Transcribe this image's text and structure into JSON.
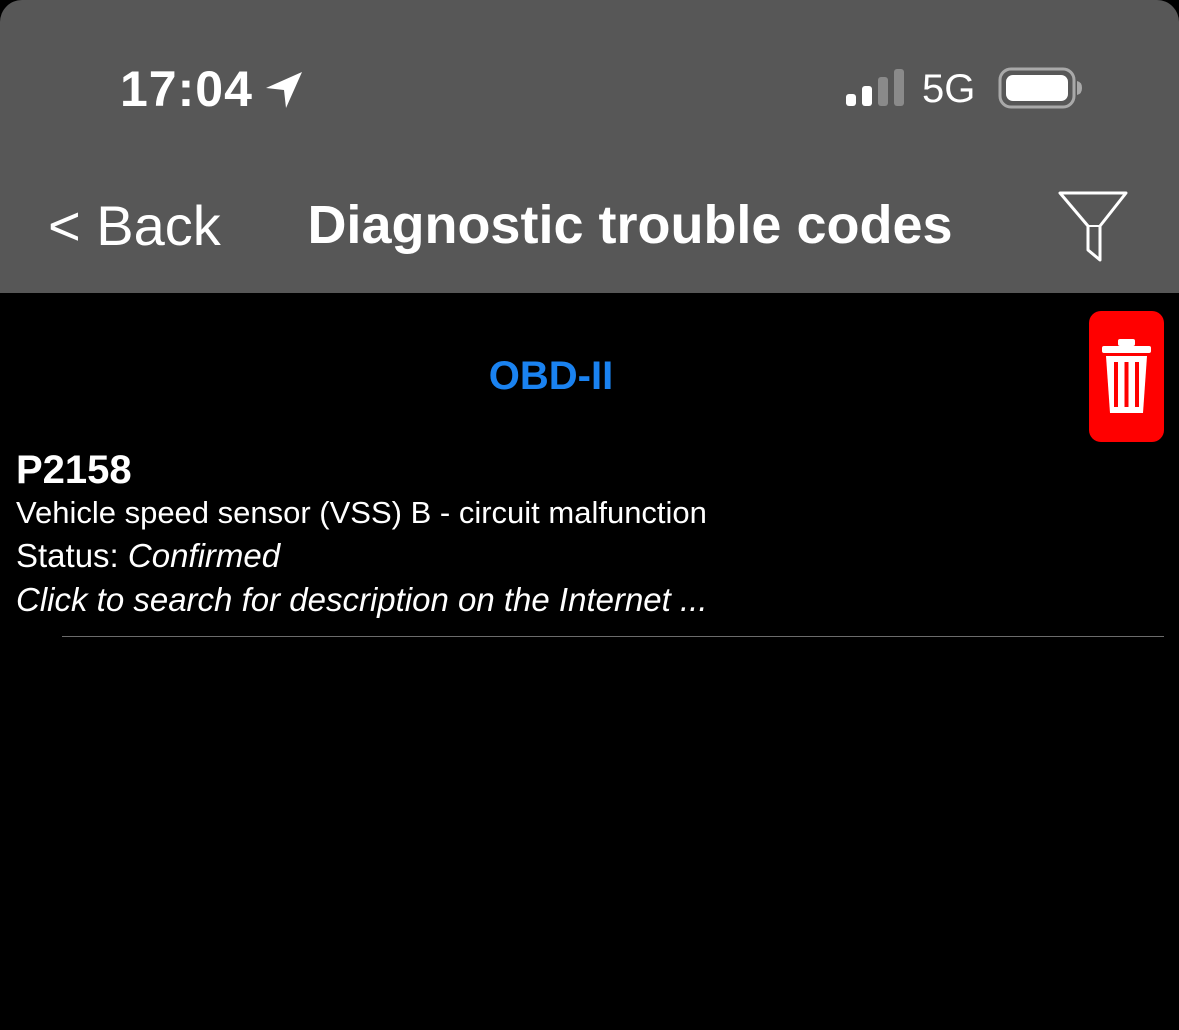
{
  "status_bar": {
    "time": "17:04",
    "network": "5G",
    "location_icon": "location-arrow-icon",
    "signal_icon": "cellular-signal-icon",
    "signal_bars_active": 2,
    "signal_bars_total": 4,
    "battery_icon": "battery-icon"
  },
  "nav": {
    "back_label": "< Back",
    "title": "Diagnostic trouble codes",
    "filter_icon": "filter-funnel-icon"
  },
  "section": {
    "header": "OBD-II",
    "delete_icon": "trash-icon"
  },
  "dtc_list": [
    {
      "code": "P2158",
      "description": "Vehicle speed sensor (VSS) B - circuit malfunction",
      "status_label": "Status: ",
      "status_value": "Confirmed",
      "search_hint": "Click to search for description on the Internet ..."
    }
  ],
  "colors": {
    "header_bg": "#575757",
    "content_bg": "#000000",
    "accent_blue": "#1a82f0",
    "delete_red": "#ff0000"
  }
}
